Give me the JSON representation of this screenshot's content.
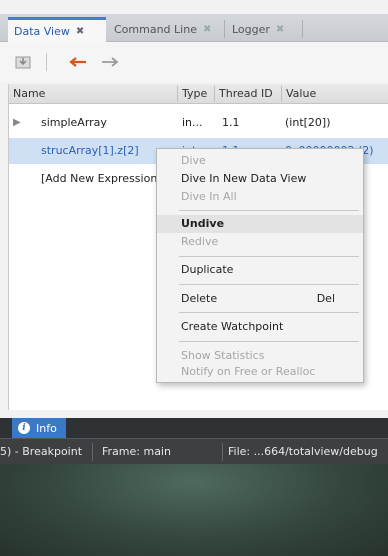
{
  "tabs": [
    {
      "label": "Data View",
      "close": "✖",
      "active": true
    },
    {
      "label": "Command Line",
      "close": "✖",
      "active": false
    },
    {
      "label": "Logger",
      "close": "✖",
      "active": false
    }
  ],
  "toolbar": {
    "icons": [
      "dive-in-all-icon",
      "back-arrow-icon",
      "forward-arrow-icon"
    ],
    "back_color": "#d9531e",
    "forward_color": "#9a9a9a"
  },
  "table": {
    "columns": [
      "Name",
      "Type",
      "Thread ID",
      "Value"
    ],
    "rows": [
      {
        "name": "simpleArray",
        "type": "in...",
        "thread": "1.1",
        "value": "(int[20])",
        "expander": "▶"
      },
      {
        "name": "strucArray[1].z[2]",
        "type": "int",
        "thread": "1.1",
        "value": "0x00000002 (2)",
        "expander": ""
      },
      {
        "name": "[Add New Expression]",
        "type": "",
        "thread": "",
        "value": "",
        "expander": ""
      }
    ]
  },
  "context_menu": {
    "dive": "Dive",
    "dive_new_view": "Dive In New Data View",
    "dive_in_all": "Dive In All",
    "undive": "Undive",
    "redive": "Redive",
    "duplicate": "Duplicate",
    "delete": "Delete",
    "delete_shortcut": "Del",
    "create_watchpoint": "Create Watchpoint",
    "show_statistics": "Show Statistics",
    "notify_free": "Notify on Free or Realloc"
  },
  "info_tab": {
    "label": "Info"
  },
  "status": {
    "breakpoint": "5) - Breakpoint",
    "frame": "Frame: main",
    "file": "File: ...664/totalview/debug"
  }
}
